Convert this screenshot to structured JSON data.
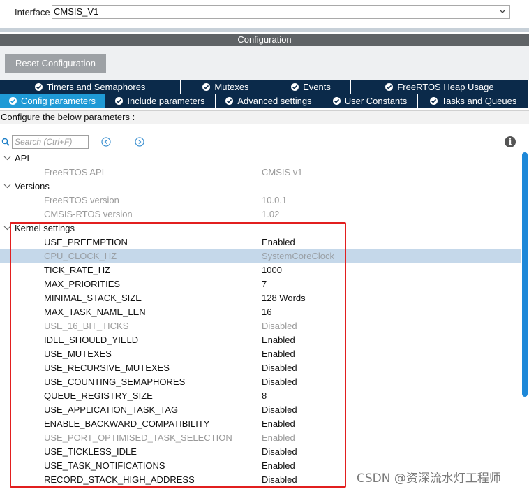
{
  "interface": {
    "label": "Interface",
    "value": "CMSIS_V1"
  },
  "configuration_title": "Configuration",
  "reset_button": "Reset Configuration",
  "tabs_row1": [
    {
      "label": "Timers and Semaphores"
    },
    {
      "label": "Mutexes"
    },
    {
      "label": "Events"
    },
    {
      "label": "FreeRTOS Heap Usage"
    }
  ],
  "tabs_row2": [
    {
      "label": "Config parameters",
      "active": true
    },
    {
      "label": "Include parameters"
    },
    {
      "label": "Advanced settings"
    },
    {
      "label": "User Constants"
    },
    {
      "label": "Tasks and Queues"
    }
  ],
  "configure_text": "Configure the below parameters :",
  "search": {
    "placeholder": "Search (Ctrl+F)"
  },
  "groups": [
    {
      "label": "API",
      "params": [
        {
          "name": "FreeRTOS API",
          "value": "CMSIS v1",
          "state": "dim"
        }
      ]
    },
    {
      "label": "Versions",
      "params": [
        {
          "name": "FreeRTOS version",
          "value": "10.0.1",
          "state": "dim"
        },
        {
          "name": "CMSIS-RTOS version",
          "value": "1.02",
          "state": "dim"
        }
      ]
    },
    {
      "label": "Kernel settings",
      "params": [
        {
          "name": "USE_PREEMPTION",
          "value": "Enabled",
          "state": "norm"
        },
        {
          "name": "CPU_CLOCK_HZ",
          "value": "SystemCoreClock",
          "state": "sel"
        },
        {
          "name": "TICK_RATE_HZ",
          "value": "1000",
          "state": "norm"
        },
        {
          "name": "MAX_PRIORITIES",
          "value": "7",
          "state": "norm"
        },
        {
          "name": "MINIMAL_STACK_SIZE",
          "value": "128 Words",
          "state": "norm"
        },
        {
          "name": "MAX_TASK_NAME_LEN",
          "value": "16",
          "state": "norm"
        },
        {
          "name": "USE_16_BIT_TICKS",
          "value": "Disabled",
          "state": "dim"
        },
        {
          "name": "IDLE_SHOULD_YIELD",
          "value": "Enabled",
          "state": "norm"
        },
        {
          "name": "USE_MUTEXES",
          "value": "Enabled",
          "state": "norm"
        },
        {
          "name": "USE_RECURSIVE_MUTEXES",
          "value": "Disabled",
          "state": "norm"
        },
        {
          "name": "USE_COUNTING_SEMAPHORES",
          "value": "Disabled",
          "state": "norm"
        },
        {
          "name": "QUEUE_REGISTRY_SIZE",
          "value": "8",
          "state": "norm"
        },
        {
          "name": "USE_APPLICATION_TASK_TAG",
          "value": "Disabled",
          "state": "norm"
        },
        {
          "name": "ENABLE_BACKWARD_COMPATIBILITY",
          "value": "Enabled",
          "state": "norm"
        },
        {
          "name": "USE_PORT_OPTIMISED_TASK_SELECTION",
          "value": "Enabled",
          "state": "dim"
        },
        {
          "name": "USE_TICKLESS_IDLE",
          "value": "Disabled",
          "state": "norm"
        },
        {
          "name": "USE_TASK_NOTIFICATIONS",
          "value": "Enabled",
          "state": "norm"
        },
        {
          "name": "RECORD_STACK_HIGH_ADDRESS",
          "value": "Disabled",
          "state": "norm"
        }
      ]
    }
  ],
  "watermark": "CSDN @资深流水灯工程师",
  "colors": {
    "tab_bg": "#0b2a4a",
    "tab_active": "#1f9ad6",
    "highlight_box": "#e21f1f",
    "selected_row": "#c5d8ea"
  }
}
